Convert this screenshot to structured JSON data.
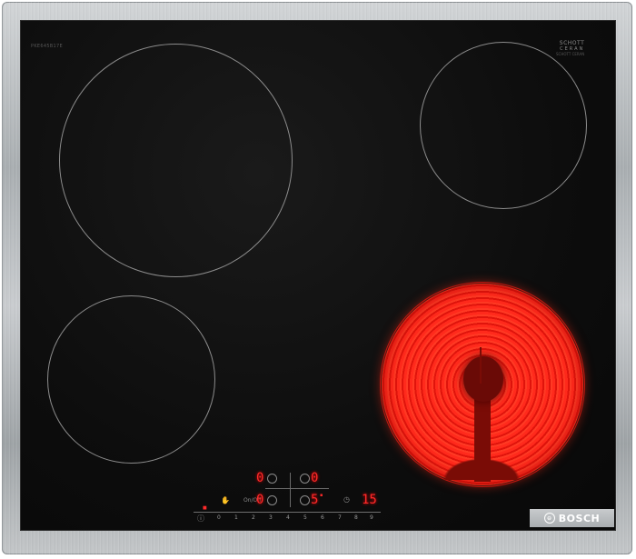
{
  "hob": {
    "model_text": "PKE645B17E",
    "glass_brand_line1": "SCHOTT",
    "glass_brand_line2": "CERAN",
    "glass_brand_line3": "SCHOTT CERAN",
    "manufacturer": "BOSCH"
  },
  "controls": {
    "top_left_level": "0",
    "top_right_level": "0",
    "bottom_left_level": "0",
    "bottom_right_level": "5",
    "timer_value": "15",
    "power_label": "On/Off",
    "scale": [
      "0",
      "1",
      "2",
      "3",
      "4",
      "5",
      "6",
      "7",
      "8",
      "9"
    ]
  },
  "colors": {
    "display": "#ff2a2a",
    "hot_zone": "#ff2416",
    "glass": "#0d0d0d",
    "frame": "#b8bcbf"
  },
  "icons": {
    "lock": "child-lock-icon",
    "power": "power-icon",
    "timer": "timer-icon"
  }
}
